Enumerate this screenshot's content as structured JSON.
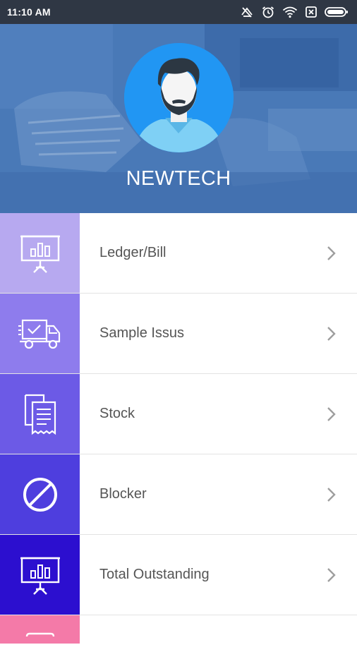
{
  "status_bar": {
    "time": "11:10 AM"
  },
  "profile": {
    "name": "NEWTECH"
  },
  "menu": {
    "items": [
      {
        "label": "Ledger/Bill",
        "icon": "presentation-chart-icon",
        "color": "#b7a9f0"
      },
      {
        "label": "Sample Issus",
        "icon": "delivery-truck-icon",
        "color": "#8e7ced"
      },
      {
        "label": "Stock",
        "icon": "documents-icon",
        "color": "#6c5ae6"
      },
      {
        "label": "Blocker",
        "icon": "block-icon",
        "color": "#4e3ede"
      },
      {
        "label": "Total Outstanding",
        "icon": "presentation-chart-icon",
        "color": "#2c0fcf"
      },
      {
        "label": "",
        "icon": "document-icon",
        "color": "#f47aa8"
      }
    ]
  },
  "colors": {
    "status_bar": "#2f3744",
    "header_overlay": "#3f72b5",
    "avatar_bg": "#2196f3",
    "label_text": "#555555",
    "chevron": "#9e9e9e"
  }
}
